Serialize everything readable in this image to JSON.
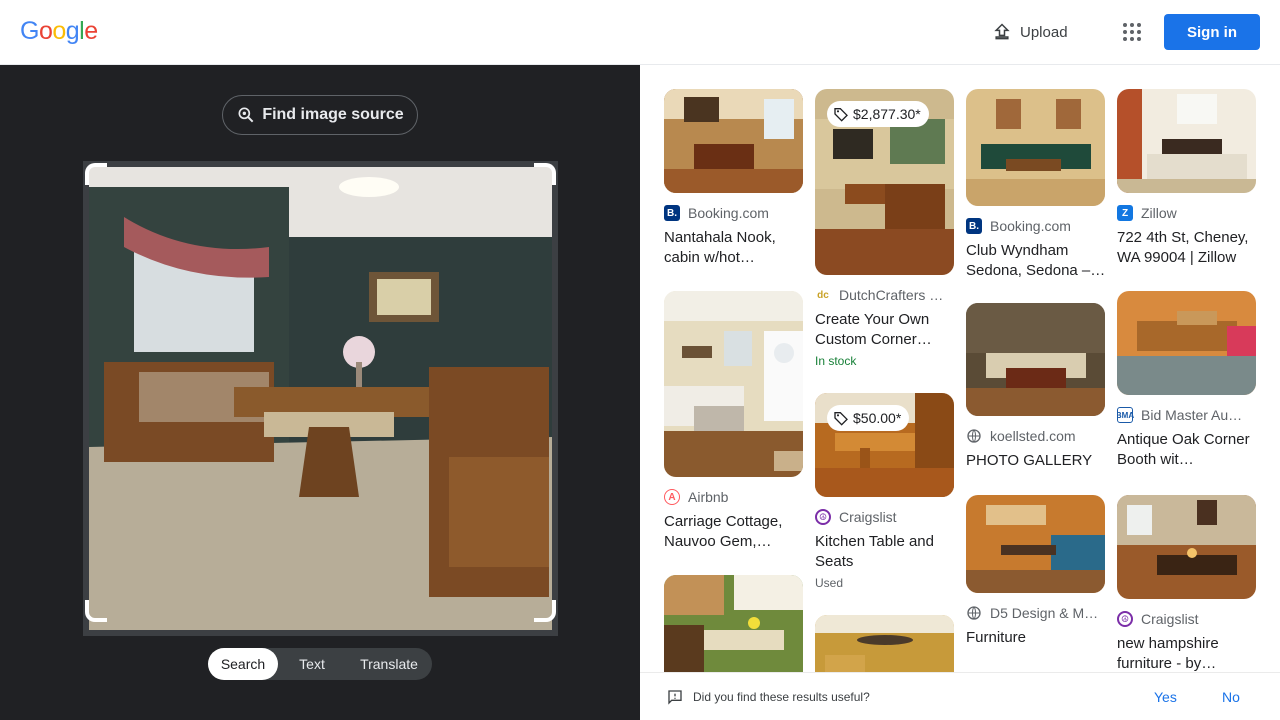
{
  "header": {
    "logo": [
      "G",
      "o",
      "o",
      "g",
      "l",
      "e"
    ],
    "logo_colors": [
      "#4285F4",
      "#EA4335",
      "#FBBC05",
      "#4285F4",
      "#34A853",
      "#EA4335"
    ],
    "upload_label": "Upload",
    "signin_label": "Sign in"
  },
  "lens": {
    "find_source_label": "Find image source",
    "tabs": [
      {
        "label": "Search",
        "active": true
      },
      {
        "label": "Text",
        "active": false
      },
      {
        "label": "Translate",
        "active": false
      }
    ]
  },
  "results": [
    {
      "source": "Booking.com",
      "favicon": "booking-icon",
      "title": "Nantahala Nook, cabin w/hot…",
      "price": "",
      "sub": ""
    },
    {
      "source": "DutchCrafters …",
      "favicon": "dutchcrafters-icon",
      "title": "Create Your Own Custom Corner…",
      "price": "$2,877.30*",
      "sub": "In stock"
    },
    {
      "source": "Booking.com",
      "favicon": "booking-icon",
      "title": "Club Wyndham Sedona, Sedona –…",
      "price": "",
      "sub": ""
    },
    {
      "source": "Zillow",
      "favicon": "zillow-icon",
      "title": "722 4th St, Cheney, WA 99004 | Zillow",
      "price": "",
      "sub": ""
    },
    {
      "source": "Airbnb",
      "favicon": "airbnb-icon",
      "title": "Carriage Cottage, Nauvoo Gem,…",
      "price": "",
      "sub": ""
    },
    {
      "source": "Craigslist",
      "favicon": "craigslist-icon",
      "title": "Kitchen Table and Seats",
      "price": "$50.00*",
      "sub": "Used"
    },
    {
      "source": "koellsted.com",
      "favicon": "globe-icon",
      "title": "PHOTO GALLERY",
      "price": "",
      "sub": ""
    },
    {
      "source": "Bid Master Au…",
      "favicon": "bma-icon",
      "title": "Antique Oak Corner Booth wit…",
      "price": "",
      "sub": ""
    },
    {
      "source": "D5 Design & M…",
      "favicon": "globe-icon",
      "title": "Furniture",
      "price": "",
      "sub": ""
    },
    {
      "source": "Craigslist",
      "favicon": "craigslist-icon",
      "title": "new hampshire furniture - by…",
      "price": "",
      "sub": ""
    }
  ],
  "feedback": {
    "question": "Did you find these results useful?",
    "yes": "Yes",
    "no": "No"
  },
  "colors": {
    "accent": "#1a73e8",
    "dark_panel": "#202124",
    "in_stock": "#188038"
  }
}
